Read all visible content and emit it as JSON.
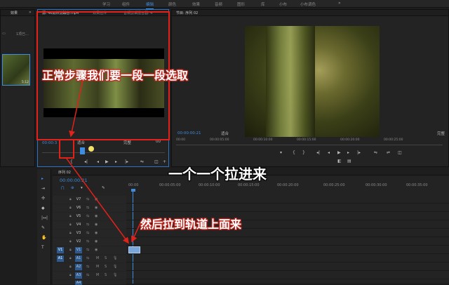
{
  "workspace_tabs": [
    {
      "label": "学习",
      "active": false
    },
    {
      "label": "组件",
      "active": false
    },
    {
      "label": "编辑",
      "active": true
    },
    {
      "label": "颜色",
      "active": false
    },
    {
      "label": "效果",
      "active": false
    },
    {
      "label": "音频",
      "active": false
    },
    {
      "label": "图形",
      "active": false
    },
    {
      "label": "库",
      "active": false
    },
    {
      "label": "小布",
      "active": false
    },
    {
      "label": "小布调色",
      "active": false
    }
  ],
  "more_glyph": "»",
  "project": {
    "tab": "效果",
    "count": "1项已...",
    "clip_duration": "5:12"
  },
  "source": {
    "tabs": [
      "源: 4k雨林流磁谷.mp4",
      "效果控件",
      "音频剪辑混合器: 4"
    ],
    "timecode": "00:00:3",
    "fit": "适合",
    "quality": "完整",
    "end_tc": "00"
  },
  "program": {
    "tab": "节目: 序列 02",
    "timecode": "00:00:00:21",
    "fit": "适合",
    "quality": "完整",
    "ruler": [
      "00:00",
      "00:00:05:00",
      "00:00:10:00",
      "00:00:15:00",
      "00:00:20:00",
      "00:00:25:00",
      "00:00:30:00",
      "00:00:35:00"
    ]
  },
  "timeline": {
    "tab": "序列 02",
    "timecode": "00:00:00:21",
    "ruler": [
      "00:00",
      "00:00:05:00",
      "00:00:10:00",
      "00:00:15:00",
      "00:00:20:00",
      "00:00:25:00",
      "00:00:30:00",
      "00:00:35:00"
    ],
    "video_tracks": [
      "V7",
      "V6",
      "V5",
      "V4",
      "V3",
      "V2",
      "V1"
    ],
    "audio_tracks": [
      "A1",
      "A2",
      "A3",
      "A4"
    ],
    "source_v": "V1",
    "source_a": "A1",
    "m_label": "M",
    "s_label": "S"
  },
  "annotations": {
    "step1": "正常步骤我们要一段一段选取",
    "step2": "一个一个拉进来",
    "step3": "然后拉到轨道上面来"
  },
  "colors": {
    "accent": "#3d8de0",
    "annotation_red": "#e0221a",
    "track_target": "#2c5a90"
  }
}
